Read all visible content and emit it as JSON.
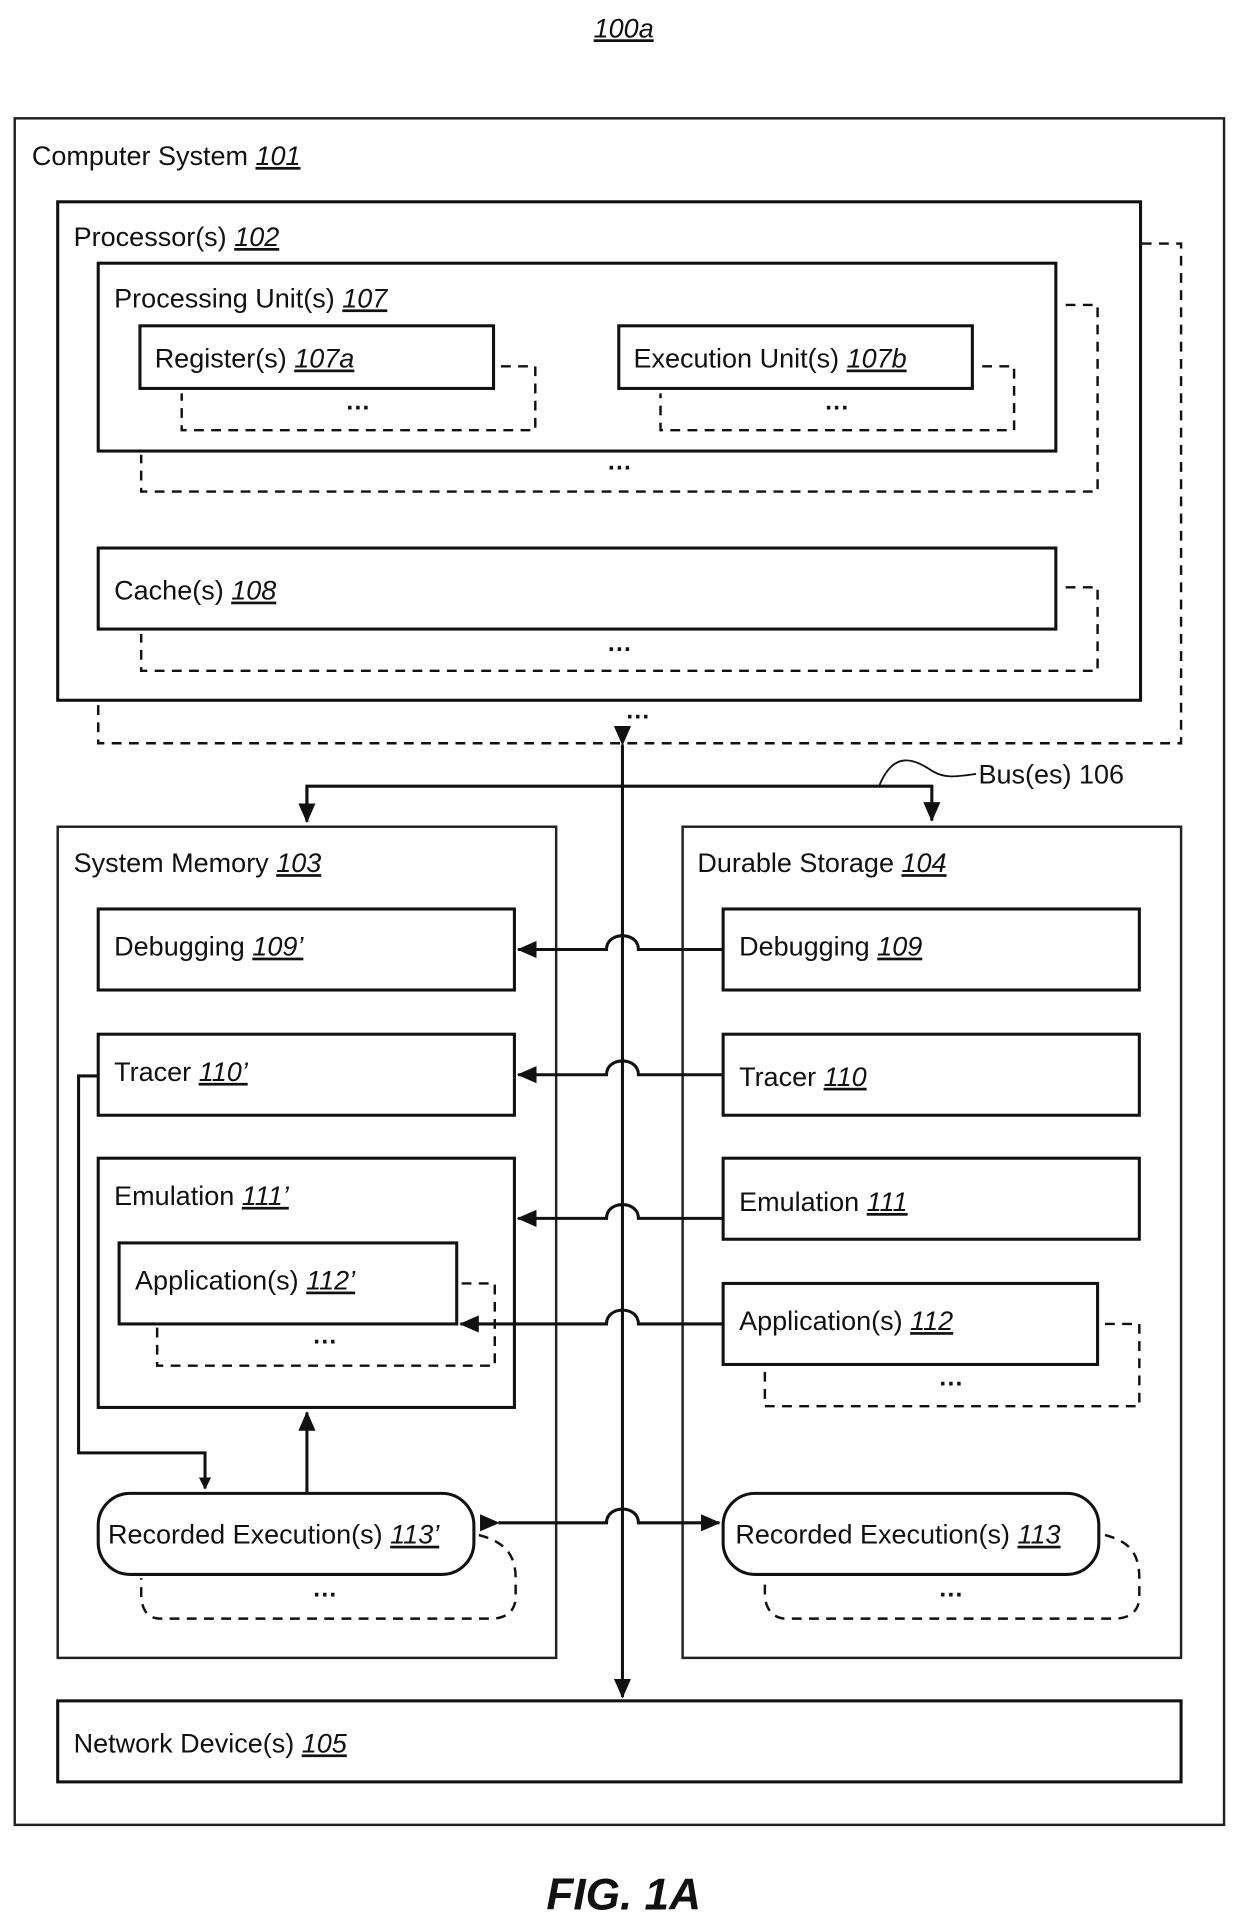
{
  "figure": {
    "ref": "100a",
    "caption": "FIG. 1A"
  },
  "computer_system": {
    "label": "Computer System ",
    "ref": "101"
  },
  "processor": {
    "label": "Processor(s) ",
    "ref": "102"
  },
  "processing_unit": {
    "label": "Processing Unit(s) ",
    "ref": "107"
  },
  "registers": {
    "label": "Register(s) ",
    "ref": "107a"
  },
  "execution_units": {
    "label": "Execution Unit(s) ",
    "ref": "107b"
  },
  "caches": {
    "label": "Cache(s) ",
    "ref": "108"
  },
  "bus": {
    "label": "Bus(es) 106"
  },
  "system_memory": {
    "label": "System Memory ",
    "ref": "103",
    "debugging": {
      "label": "Debugging ",
      "ref": "109’"
    },
    "tracer": {
      "label": "Tracer ",
      "ref": "110’"
    },
    "emulation": {
      "label": "Emulation ",
      "ref": "111’"
    },
    "applications": {
      "label": "Application(s) ",
      "ref": "112’"
    },
    "recorded": {
      "label": "Recorded Execution(s) ",
      "ref": "113’"
    }
  },
  "durable_storage": {
    "label": "Durable Storage ",
    "ref": "104",
    "debugging": {
      "label": "Debugging ",
      "ref": "109"
    },
    "tracer": {
      "label": "Tracer ",
      "ref": "110"
    },
    "emulation": {
      "label": "Emulation ",
      "ref": "111"
    },
    "applications": {
      "label": "Application(s) ",
      "ref": "112"
    },
    "recorded": {
      "label": "Recorded Execution(s) ",
      "ref": "113"
    }
  },
  "network": {
    "label": "Network Device(s) ",
    "ref": "105"
  },
  "ellipsis": "..."
}
